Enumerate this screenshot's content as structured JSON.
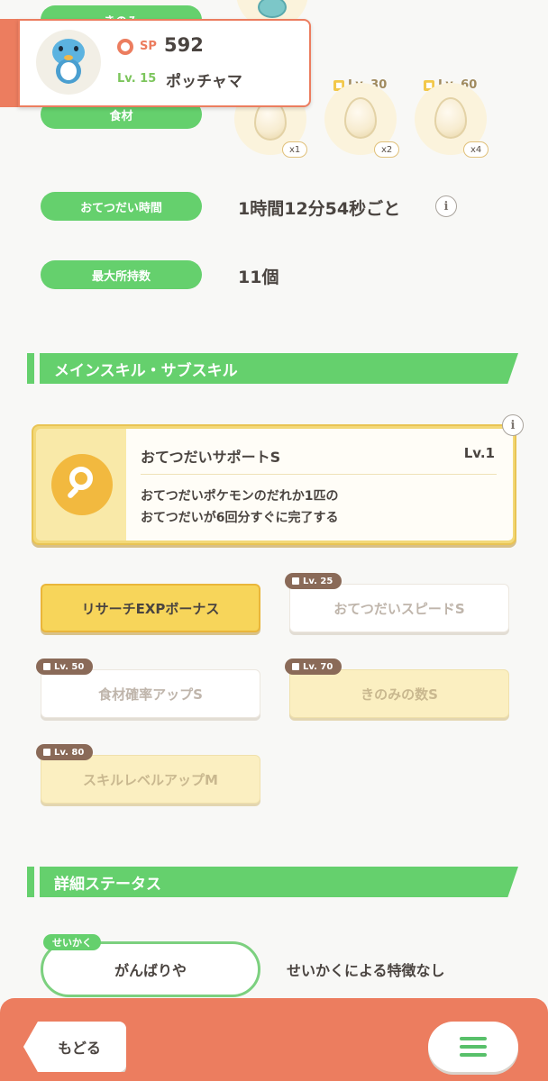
{
  "header": {
    "sp_label": "SP",
    "sp_value": "592",
    "level": "Lv. 15",
    "name": "ポッチャマ"
  },
  "top_rows": {
    "berry_label": "きのみ",
    "ingredient_label": "食材"
  },
  "ingredients": [
    {
      "lock": "",
      "mult": "x1"
    },
    {
      "lock": "Lv. 30",
      "mult": "x2"
    },
    {
      "lock": "Lv. 60",
      "mult": "x4"
    }
  ],
  "help_time": {
    "label": "おてつだい時間",
    "value": "1時間12分54秒ごと"
  },
  "max_carry": {
    "label": "最大所持数",
    "value": "11個"
  },
  "skills_section": {
    "title": "メインスキル・サブスキル"
  },
  "main_skill": {
    "name": "おてつだいサポートS",
    "level": "Lv.1",
    "desc_line1": "おてつだいポケモンのだれか1匹の",
    "desc_line2": "おてつだいが6回分すぐに完了する"
  },
  "sub_skills": [
    {
      "label": "リサーチEXPボーナス",
      "lock": ""
    },
    {
      "label": "おてつだいスピードS",
      "lock": "Lv. 25"
    },
    {
      "label": "食材確率アップS",
      "lock": "Lv. 50"
    },
    {
      "label": "きのみの数S",
      "lock": "Lv. 70"
    },
    {
      "label": "スキルレベルアップM",
      "lock": "Lv. 80"
    }
  ],
  "detail_section": {
    "title": "詳細ステータス"
  },
  "nature": {
    "tag": "せいかく",
    "value": "がんばりや",
    "effect": "せいかくによる特徴なし"
  },
  "footer": {
    "back": "もどる"
  },
  "colors": {
    "accent_green": "#65d06d",
    "footer_orange": "#ec7d5f",
    "gold": "#f2c84b"
  }
}
